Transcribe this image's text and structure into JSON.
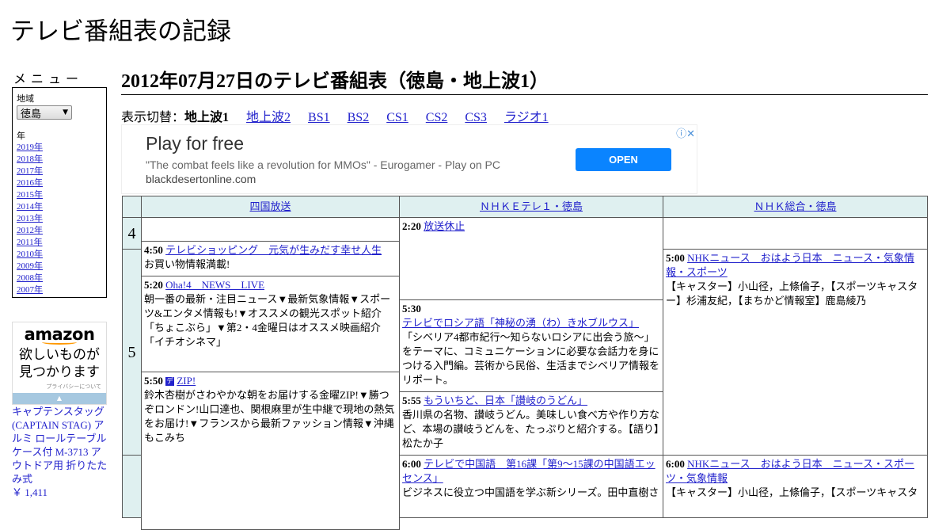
{
  "site_title": "テレビ番組表の記録",
  "menu": {
    "label": "メニュー",
    "region_label": "地域",
    "region_value": "徳島",
    "year_label": "年",
    "years": [
      "2019年",
      "2018年",
      "2017年",
      "2016年",
      "2015年",
      "2014年",
      "2013年",
      "2012年",
      "2011年",
      "2010年",
      "2009年",
      "2008年",
      "2007年"
    ]
  },
  "amazon": {
    "logo": "amazon",
    "catch1": "欲しいものが",
    "catch2": "見つかります",
    "privacy": "プライバシーについて",
    "product": "キャプテンスタッグ(CAPTAIN STAG) アルミ ロールテーブル ケース付 M-3713 アウトドア用 折りたたみ式",
    "price": "￥ 1,411"
  },
  "heading": "2012年07月27日のテレビ番組表（徳島・地上波1）",
  "switcher": {
    "label": "表示切替：",
    "current": "地上波1",
    "links": [
      "地上波2",
      "BS1",
      "BS2",
      "CS1",
      "CS2",
      "CS3",
      "ラジオ1"
    ]
  },
  "ad": {
    "headline": "Play for free",
    "desc": "\"The combat feels like a revolution for MMOs\" - Eurogamer - Play on PC",
    "url": "blackdesertonline.com",
    "button": "OPEN"
  },
  "channels": [
    "四国放送",
    "ＮＨＫＥテレ１・徳島",
    "ＮＨＫ総合・徳島"
  ],
  "hours": [
    "4",
    "5",
    ""
  ],
  "programs": [
    {
      "time": "4:50",
      "title": "テレビショッピング　元気が生みだす幸せ人生",
      "desc": "お買い物情報満載!"
    },
    {
      "time": "5:20",
      "title": "Oha!4　NEWS　LIVE",
      "desc": "朝一番の最新・注目ニュース▼最新気象情報▼スポーツ&エンタメ情報も!▼オススメの観光スポット紹介「ちょこぶら」▼第2・4金曜日はオススメ映画紹介「イチオシネマ」"
    },
    {
      "time": "5:50",
      "badge": "デ",
      "title": "ZIP!",
      "desc": "鈴木杏樹がさわやかな朝をお届けする金曜ZIP!▼勝つぞロンドン!山口達也、関根麻里が生中継で現地の熱気をお届け!▼フランスから最新ファッション情報▼沖縄もこみち"
    },
    {
      "time": "2:20",
      "title": "放送休止",
      "desc": ""
    },
    {
      "time": "5:30",
      "title": "テレビでロシア語「神秘の湧（わ）き水ブルウス」",
      "desc": "「シベリア4都市紀行～知らないロシアに出会う旅～」をテーマに、コミュニケーションに必要な会話力を身につける入門編。芸術から民俗、生活までシベリア情報をリポート。"
    },
    {
      "time": "5:55",
      "title": "もういちど、日本「讃岐のうどん」",
      "desc": "香川県の名物、讃岐うどん。美味しい食べ方や作り方など、本場の讃岐うどんを、たっぷりと紹介する。【語り】松たか子"
    },
    {
      "time": "6:00",
      "title": "テレビで中国語　第16課「第9～15課の中国語エッセンス」",
      "desc": "ビジネスに役立つ中国語を学ぶ新シリーズ。田中直樹さ"
    },
    {
      "time": "5:00",
      "title": "NHKニュース　おはよう日本　ニュース・気象情報・スポーツ",
      "desc": "【キャスター】小山径，上條倫子，【スポーツキャスター】杉浦友紀，【まちかど情報室】鹿島綾乃"
    },
    {
      "time": "6:00",
      "title": "NHKニュース　おはよう日本　ニュース・スポーツ・気象情報",
      "desc": "【キャスター】小山径，上條倫子，【スポーツキャスタ"
    }
  ]
}
